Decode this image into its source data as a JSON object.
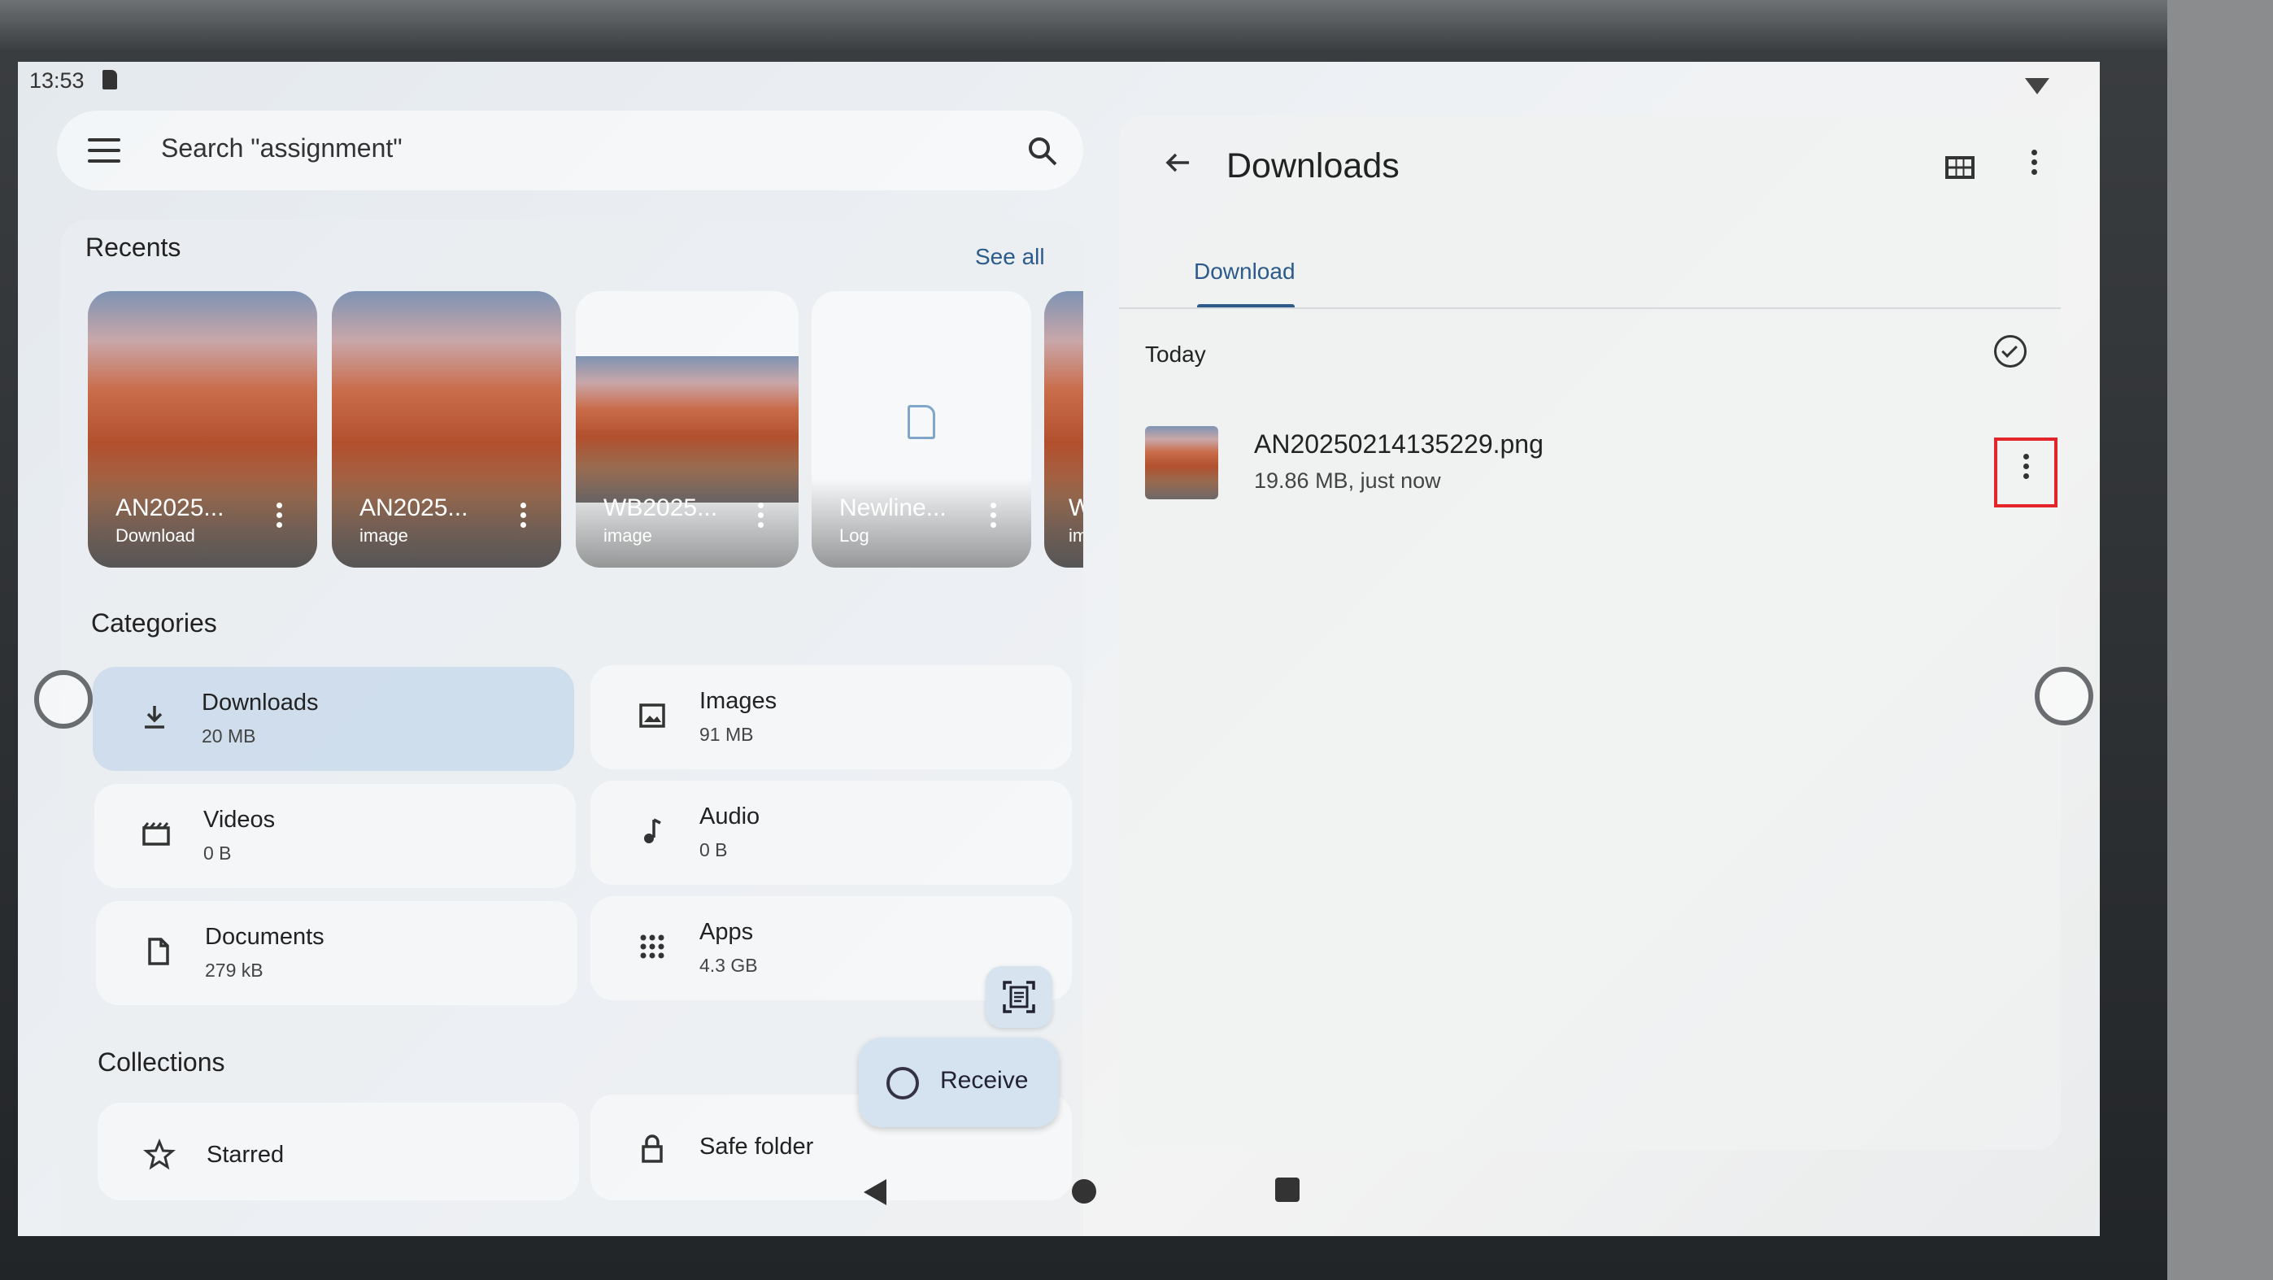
{
  "status_bar": {
    "time": "13:53"
  },
  "search": {
    "placeholder": "Search \"assignment\""
  },
  "recents": {
    "title": "Recents",
    "see_all": "See all",
    "items": [
      {
        "name": "AN2025...",
        "sub": "Download"
      },
      {
        "name": "AN2025...",
        "sub": "image"
      },
      {
        "name": "WB2025...",
        "sub": "image"
      },
      {
        "name": "Newline...",
        "sub": "Log"
      },
      {
        "name": "W",
        "sub": "im"
      }
    ]
  },
  "categories": {
    "title": "Categories",
    "items": [
      {
        "name": "Downloads",
        "size": "20 MB",
        "icon": "download-icon"
      },
      {
        "name": "Images",
        "size": "91 MB",
        "icon": "image-icon"
      },
      {
        "name": "Videos",
        "size": "0 B",
        "icon": "video-icon"
      },
      {
        "name": "Audio",
        "size": "0 B",
        "icon": "music-note-icon"
      },
      {
        "name": "Documents",
        "size": "279 kB",
        "icon": "document-icon"
      },
      {
        "name": "Apps",
        "size": "4.3 GB",
        "icon": "apps-grid-icon"
      }
    ]
  },
  "collections": {
    "title": "Collections",
    "items": [
      {
        "name": "Starred",
        "icon": "star-icon"
      },
      {
        "name": "Safe folder",
        "icon": "lock-icon"
      }
    ]
  },
  "receive": {
    "label": "Receive"
  },
  "downloads_panel": {
    "title": "Downloads",
    "tab": "Download",
    "group_label": "Today",
    "files": [
      {
        "name": "AN20250214135229.png",
        "meta": "19.86 MB, just now"
      }
    ]
  },
  "colors": {
    "accent": "#2c5a8a",
    "highlight": "#e3242b",
    "notification_dot": "#e53935"
  }
}
